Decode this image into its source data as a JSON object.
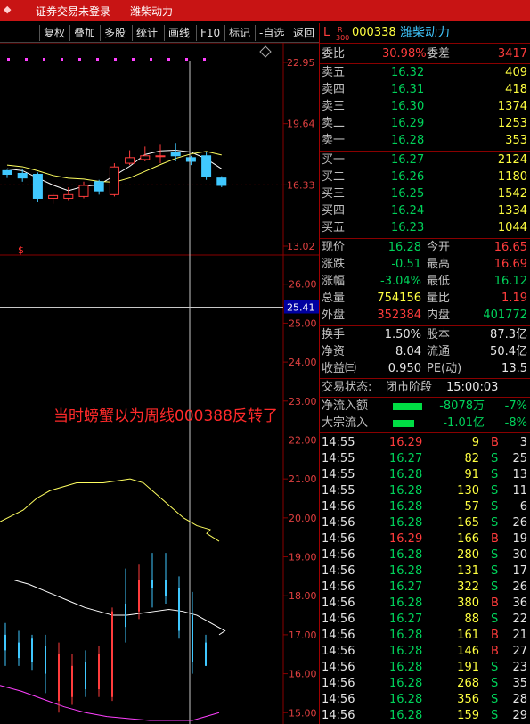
{
  "topbar": {
    "logo": "◆",
    "items": [
      "证券交易未登录",
      "潍柴动力"
    ]
  },
  "toolbar": {
    "buttons": [
      "复权",
      "叠加",
      "多股",
      "统计",
      "画线",
      "F10",
      "标记",
      "-自选",
      "返回"
    ]
  },
  "chart": {
    "upper_price_labels": [
      "22.95",
      "19.64",
      "16.33",
      "13.02"
    ],
    "lower_price_labels": [
      "26.00",
      "25.00",
      "24.00",
      "23.00",
      "22.00",
      "21.00",
      "20.00",
      "19.00",
      "18.00",
      "17.00",
      "16.00",
      "15.00"
    ],
    "cursor_price": "25.41",
    "s_marker": "$",
    "annotation": "当时螃蟹以为周线000388反转了",
    "colors": {
      "up": "#ff3c3c",
      "down": "#40c8ff",
      "ma1": "#ffffff",
      "ma2": "#ffff60",
      "ma3": "#ff40ff",
      "grid": "#8a0000"
    }
  },
  "quote": {
    "header": {
      "market_tag": "L",
      "sub_tag_top": "R",
      "sub_tag_bottom": "300",
      "code": "000338",
      "name": "潍柴动力"
    },
    "weibi": {
      "label": "委比",
      "value": "30.98%",
      "label2": "委差",
      "value2": "3417"
    },
    "asks": [
      {
        "label": "卖五",
        "price": "16.32",
        "vol": "409"
      },
      {
        "label": "卖四",
        "price": "16.31",
        "vol": "418"
      },
      {
        "label": "卖三",
        "price": "16.30",
        "vol": "1374"
      },
      {
        "label": "卖二",
        "price": "16.29",
        "vol": "1253"
      },
      {
        "label": "卖一",
        "price": "16.28",
        "vol": "353"
      }
    ],
    "bids": [
      {
        "label": "买一",
        "price": "16.27",
        "vol": "2124"
      },
      {
        "label": "买二",
        "price": "16.26",
        "vol": "1180"
      },
      {
        "label": "买三",
        "price": "16.25",
        "vol": "1542"
      },
      {
        "label": "买四",
        "price": "16.24",
        "vol": "1334"
      },
      {
        "label": "买五",
        "price": "16.23",
        "vol": "1044"
      }
    ],
    "stats": [
      {
        "l1": "现价",
        "v1": "16.28",
        "c1": "dn",
        "l2": "今开",
        "v2": "16.65",
        "c2": "up"
      },
      {
        "l1": "涨跌",
        "v1": "-0.51",
        "c1": "dn",
        "l2": "最高",
        "v2": "16.69",
        "c2": "up"
      },
      {
        "l1": "涨幅",
        "v1": "-3.04%",
        "c1": "dn",
        "l2": "最低",
        "v2": "16.12",
        "c2": "dn"
      },
      {
        "l1": "总量",
        "v1": "754156",
        "c1": "yl",
        "l2": "量比",
        "v2": "1.19",
        "c2": "up"
      },
      {
        "l1": "外盘",
        "v1": "352384",
        "c1": "up",
        "l2": "内盘",
        "v2": "401772",
        "c2": "dn"
      }
    ],
    "finance": [
      {
        "l1": "换手",
        "v1": "1.50%",
        "l2": "股本",
        "v2": "87.3亿"
      },
      {
        "l1": "净资",
        "v1": "8.04",
        "l2": "流通",
        "v2": "50.4亿"
      },
      {
        "l1": "收益㈢",
        "v1": "0.950",
        "l2": "PE(动)",
        "v2": "13.5"
      }
    ],
    "status": {
      "label": "交易状态:",
      "value": "闭市阶段",
      "time": "15:00:03"
    },
    "flows": [
      {
        "label": "净流入额",
        "value": "-8078万",
        "pct": "-7%",
        "bar": 0.55
      },
      {
        "label": "大宗流入",
        "value": "-1.01亿",
        "pct": "-8%",
        "bar": 0.4
      }
    ],
    "ticks": [
      {
        "time": "14:55",
        "price": "16.29",
        "pc": "up",
        "vol": "9",
        "vc": "yl",
        "side": "B",
        "n": "3"
      },
      {
        "time": "14:55",
        "price": "16.27",
        "pc": "dn",
        "vol": "82",
        "vc": "yl",
        "side": "S",
        "n": "25"
      },
      {
        "time": "14:55",
        "price": "16.28",
        "pc": "dn",
        "vol": "91",
        "vc": "yl",
        "side": "S",
        "n": "13"
      },
      {
        "time": "14:55",
        "price": "16.28",
        "pc": "dn",
        "vol": "130",
        "vc": "yl",
        "side": "S",
        "n": "11"
      },
      {
        "time": "14:56",
        "price": "16.28",
        "pc": "dn",
        "vol": "57",
        "vc": "yl",
        "side": "S",
        "n": "6"
      },
      {
        "time": "14:56",
        "price": "16.28",
        "pc": "dn",
        "vol": "165",
        "vc": "yl",
        "side": "S",
        "n": "26"
      },
      {
        "time": "14:56",
        "price": "16.29",
        "pc": "up",
        "vol": "166",
        "vc": "yl",
        "side": "B",
        "n": "19"
      },
      {
        "time": "14:56",
        "price": "16.28",
        "pc": "dn",
        "vol": "280",
        "vc": "yl",
        "side": "S",
        "n": "30"
      },
      {
        "time": "14:56",
        "price": "16.28",
        "pc": "dn",
        "vol": "131",
        "vc": "yl",
        "side": "S",
        "n": "17"
      },
      {
        "time": "14:56",
        "price": "16.27",
        "pc": "dn",
        "vol": "322",
        "vc": "yl",
        "side": "S",
        "n": "26"
      },
      {
        "time": "14:56",
        "price": "16.28",
        "pc": "dn",
        "vol": "380",
        "vc": "yl",
        "side": "B",
        "n": "36"
      },
      {
        "time": "14:56",
        "price": "16.27",
        "pc": "dn",
        "vol": "88",
        "vc": "yl",
        "side": "S",
        "n": "22"
      },
      {
        "time": "14:56",
        "price": "16.28",
        "pc": "dn",
        "vol": "161",
        "vc": "yl",
        "side": "B",
        "n": "21"
      },
      {
        "time": "14:56",
        "price": "16.28",
        "pc": "dn",
        "vol": "146",
        "vc": "yl",
        "side": "B",
        "n": "27"
      },
      {
        "time": "14:56",
        "price": "16.28",
        "pc": "dn",
        "vol": "191",
        "vc": "yl",
        "side": "S",
        "n": "23"
      },
      {
        "time": "14:56",
        "price": "16.28",
        "pc": "dn",
        "vol": "268",
        "vc": "yl",
        "side": "S",
        "n": "35"
      },
      {
        "time": "14:56",
        "price": "16.28",
        "pc": "dn",
        "vol": "356",
        "vc": "yl",
        "side": "S",
        "n": "28"
      },
      {
        "time": "14:56",
        "price": "16.28",
        "pc": "dn",
        "vol": "159",
        "vc": "yl",
        "side": "S",
        "n": "29"
      }
    ]
  },
  "chart_data": [
    {
      "type": "candlestick",
      "title": "",
      "ylim": [
        13.02,
        22.95
      ],
      "yticks": [
        22.95,
        19.64,
        16.33,
        13.02
      ],
      "candles": [
        {
          "o": 17.1,
          "c": 16.9,
          "h": 17.15,
          "l": 16.7
        },
        {
          "o": 16.95,
          "c": 16.7,
          "h": 17.2,
          "l": 16.5
        },
        {
          "o": 16.9,
          "c": 15.6,
          "h": 17.0,
          "l": 15.4
        },
        {
          "o": 15.6,
          "c": 15.75,
          "h": 15.9,
          "l": 15.3
        },
        {
          "o": 15.6,
          "c": 15.8,
          "h": 16.2,
          "l": 15.5
        },
        {
          "o": 15.7,
          "c": 16.3,
          "h": 16.5,
          "l": 15.6
        },
        {
          "o": 16.5,
          "c": 16.0,
          "h": 16.6,
          "l": 15.8
        },
        {
          "o": 15.8,
          "c": 17.3,
          "h": 17.5,
          "l": 15.7
        },
        {
          "o": 17.5,
          "c": 17.8,
          "h": 18.2,
          "l": 17.4
        },
        {
          "o": 17.7,
          "c": 17.9,
          "h": 18.4,
          "l": 17.6
        },
        {
          "o": 17.9,
          "c": 17.9,
          "h": 18.5,
          "l": 17.5
        },
        {
          "o": 18.1,
          "c": 17.9,
          "h": 18.6,
          "l": 17.6
        },
        {
          "o": 17.8,
          "c": 17.6,
          "h": 17.9,
          "l": 17.4
        },
        {
          "o": 17.9,
          "c": 16.8,
          "h": 18.1,
          "l": 16.6
        },
        {
          "o": 16.7,
          "c": 16.3,
          "h": 16.8,
          "l": 16.2
        }
      ]
    },
    {
      "type": "candlestick",
      "title": "",
      "ylim": [
        14.8,
        26.2
      ],
      "yticks": [
        26,
        25,
        24,
        23,
        22,
        21,
        20,
        19,
        18,
        17,
        16,
        15
      ],
      "candles": [
        {
          "o": 17.0,
          "c": 16.6,
          "h": 17.3,
          "l": 16.2
        },
        {
          "o": 16.8,
          "c": 16.4,
          "h": 17.1,
          "l": 16.2
        },
        {
          "o": 16.9,
          "c": 16.3,
          "h": 17.0,
          "l": 16.1
        },
        {
          "o": 16.7,
          "c": 16.0,
          "h": 17.0,
          "l": 15.5
        },
        {
          "o": 15.3,
          "c": 16.5,
          "h": 16.8,
          "l": 15.0
        },
        {
          "o": 15.4,
          "c": 16.2,
          "h": 16.5,
          "l": 15.2
        },
        {
          "o": 16.3,
          "c": 15.6,
          "h": 16.6,
          "l": 15.4
        },
        {
          "o": 15.6,
          "c": 16.5,
          "h": 16.7,
          "l": 15.4
        },
        {
          "o": 15.4,
          "c": 17.6,
          "h": 17.7,
          "l": 15.3
        },
        {
          "o": 17.8,
          "c": 17.2,
          "h": 18.7,
          "l": 16.8
        },
        {
          "o": 17.6,
          "c": 18.4,
          "h": 18.8,
          "l": 17.4
        },
        {
          "o": 18.4,
          "c": 18.2,
          "h": 19.1,
          "l": 17.7
        },
        {
          "o": 18.4,
          "c": 18.0,
          "h": 19.1,
          "l": 17.8
        },
        {
          "o": 18.2,
          "c": 17.1,
          "h": 18.5,
          "l": 16.9
        },
        {
          "o": 17.5,
          "c": 16.3,
          "h": 18.1,
          "l": 16.0
        },
        {
          "o": 16.8,
          "c": 16.2,
          "h": 17.0,
          "l": 16.2
        }
      ]
    }
  ]
}
